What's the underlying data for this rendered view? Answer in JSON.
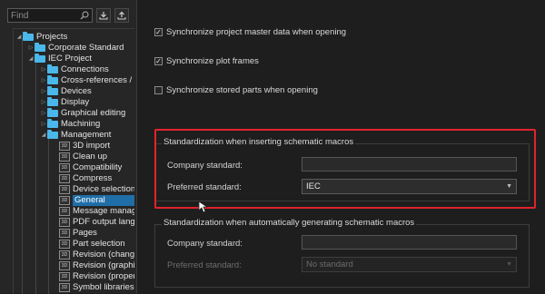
{
  "search": {
    "placeholder": "Find"
  },
  "toolbar": {
    "import_icon": "import-icon",
    "export_icon": "export-icon"
  },
  "tree": {
    "projects": "Projects",
    "corporate_standard": "Corporate Standard",
    "iec_project": "IEC Project",
    "connections": "Connections",
    "cross_references": "Cross-references / co",
    "devices": "Devices",
    "display": "Display",
    "graphical_editing": "Graphical editing",
    "machining": "Machining",
    "management": "Management",
    "items": [
      "3D import",
      "Clean up",
      "Compatibility",
      "Compress",
      "Device selection",
      "General",
      "Message manage",
      "PDF output langu",
      "Pages",
      "Part selection",
      "Revision (change",
      "Revision (graphic",
      "Revision (propert",
      "Symbol libraries"
    ],
    "page_icon_text": "3D"
  },
  "options": {
    "sync_master": {
      "label": "Synchronize project master data when opening",
      "checked": true
    },
    "sync_plot": {
      "label": "Synchronize plot frames",
      "checked": true
    },
    "sync_parts": {
      "label": "Synchronize stored parts when opening",
      "checked": false
    }
  },
  "group1": {
    "title": "Standardization when inserting schematic macros",
    "company_label": "Company standard:",
    "company_value": "",
    "preferred_label": "Preferred standard:",
    "preferred_value": "IEC"
  },
  "group2": {
    "title": "Standardization when automatically generating schematic macros",
    "company_label": "Company standard:",
    "company_value": "",
    "preferred_label": "Preferred standard:",
    "preferred_value": "No standard"
  },
  "colors": {
    "highlight": "#e0242c",
    "selection": "#1f6ea8",
    "folder": "#4ab8ea"
  }
}
